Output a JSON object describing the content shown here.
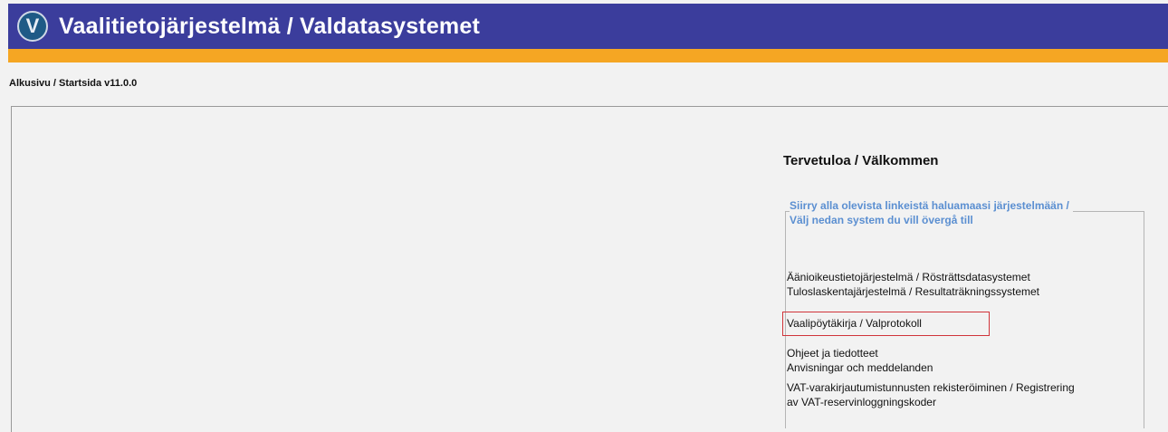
{
  "header": {
    "logo_letter": "V",
    "title": "Vaalitietojärjestelmä / Valdatasystemet",
    "colors": {
      "banner": "#3b3d9c",
      "accent_bar": "#f5a623"
    }
  },
  "breadcrumb": "Alkusivu / Startsida v11.0.0",
  "main": {
    "welcome": "Tervetuloa / Välkommen",
    "panel": {
      "legend_line1": "Siirry alla olevista linkeistä haluamaasi järjestelmään /",
      "legend_line2": "Välj nedan system du vill övergå till",
      "legend_color": "#5b8fd1"
    },
    "links": [
      "Äänioikeustietojärjestelmä / Rösträttsdatasystemet",
      "Tuloslaskentajärjestelmä / Resultaträkningssystemet",
      "Vaalipöytäkirja / Valprotokoll",
      "Ohjeet ja tiedotteet",
      "Anvisningar och meddelanden",
      "VAT-varakirjautumistunnusten rekisteröiminen / Registrering",
      "av VAT-reservinloggningskoder"
    ],
    "highlight_color": "#d0343a"
  }
}
